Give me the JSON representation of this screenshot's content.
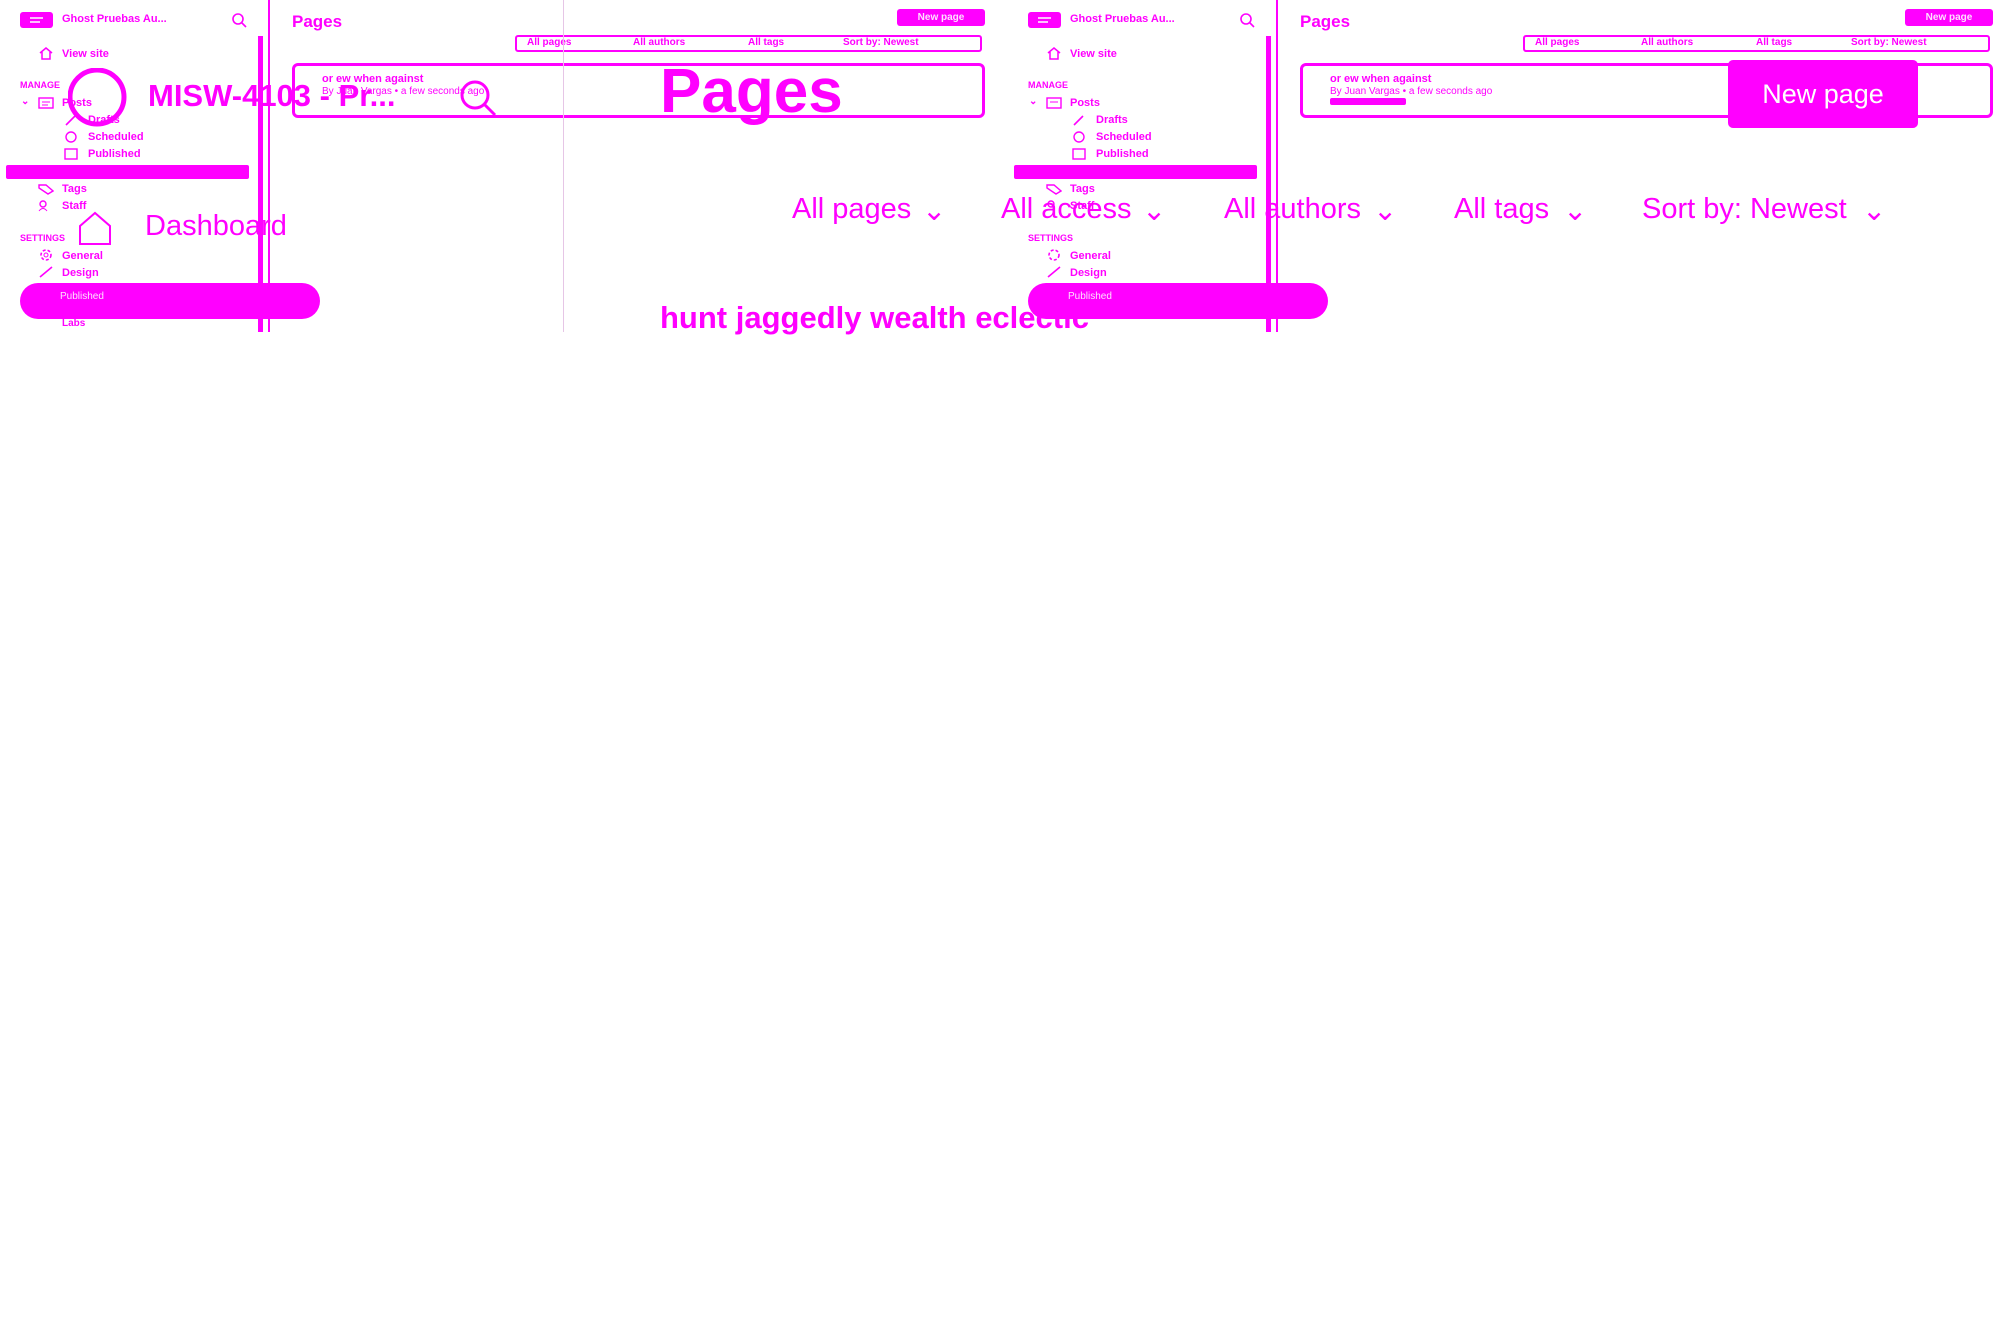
{
  "app": {
    "site_title": "Ghost Pruebas Au...",
    "brand_large": "MISW-4103 - Pr...",
    "brand_color": "#ff00ff"
  },
  "sidebar": {
    "view_site": "View site",
    "dashboard": "Dashboard",
    "manage_heading": "MANAGE",
    "posts": "Posts",
    "posts_children": [
      "Drafts",
      "Scheduled",
      "Published"
    ],
    "tags": "Tags",
    "staff": "Staff",
    "settings_heading": "SETTINGS",
    "general": "General",
    "design": "Design",
    "labs": "Labs",
    "bottom_item": "Published"
  },
  "page": {
    "title": "Pages",
    "new_page_label": "New page",
    "filters": [
      "All pages",
      "All authors",
      "All tags",
      "Sort by: Newest"
    ],
    "filters_large": [
      "All pages",
      "All access",
      "All authors",
      "All tags",
      "Sort by: Newest"
    ],
    "item": {
      "title": "or ew when against",
      "meta": "By Juan Vargas • a few seconds ago"
    },
    "overlay_text": "hunt jaggedly wealth eclectic"
  },
  "icons": {
    "menu": "menu-icon",
    "search": "search-icon",
    "home": "home-icon",
    "chevron": "chevron-down-icon",
    "tag": "tag-icon",
    "staff": "staff-icon",
    "gear": "gear-icon",
    "brush": "brush-icon"
  }
}
